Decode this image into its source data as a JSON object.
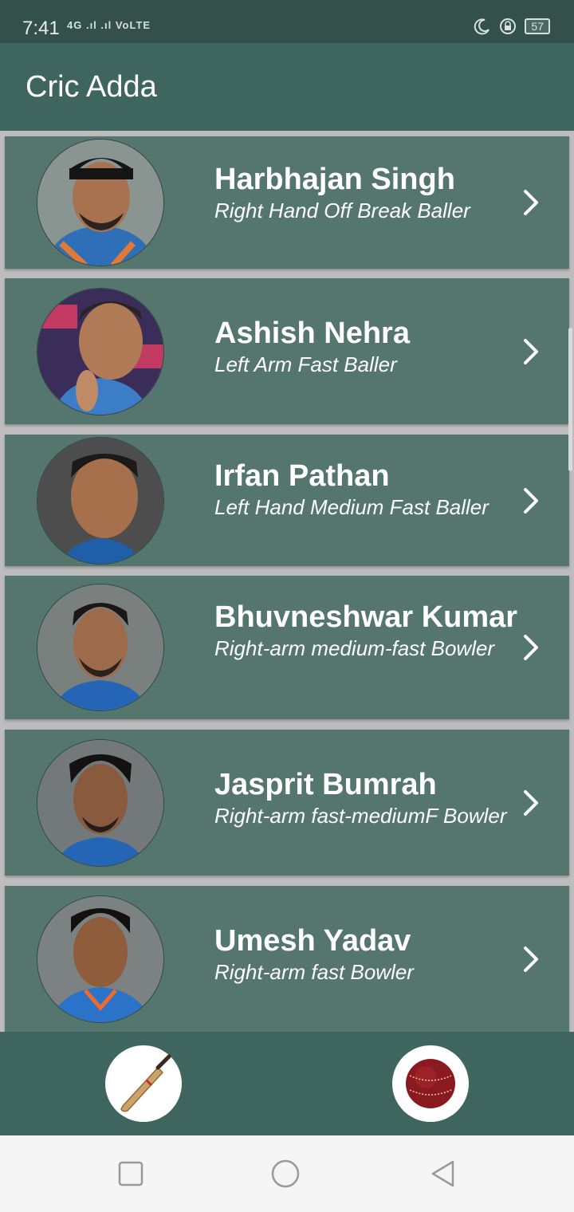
{
  "status_bar": {
    "time": "7:41",
    "network": "4G  .ıl  .ıl  VoLTE",
    "battery": "57"
  },
  "app_bar": {
    "title": "Cric Adda"
  },
  "players": [
    {
      "name": "Harbhajan Singh",
      "role": "Right Hand Off Break Baller"
    },
    {
      "name": "Ashish Nehra",
      "role": "Left Arm Fast Baller"
    },
    {
      "name": "Irfan Pathan",
      "role": "Left Hand Medium Fast Baller"
    },
    {
      "name": "Bhuvneshwar Kumar",
      "role": "Right-arm medium-fast Bowler"
    },
    {
      "name": "Jasprit Bumrah",
      "role": "Right-arm fast-mediumF Bowler"
    },
    {
      "name": "Umesh Yadav",
      "role": "Right-arm fast Bowler"
    }
  ],
  "bottom_bar": {
    "left_icon": "cricket-bat-icon",
    "right_icon": "cricket-ball-icon"
  },
  "colors": {
    "primary": "#3f665e",
    "card": "#55756f",
    "background": "#bdbdbd"
  }
}
